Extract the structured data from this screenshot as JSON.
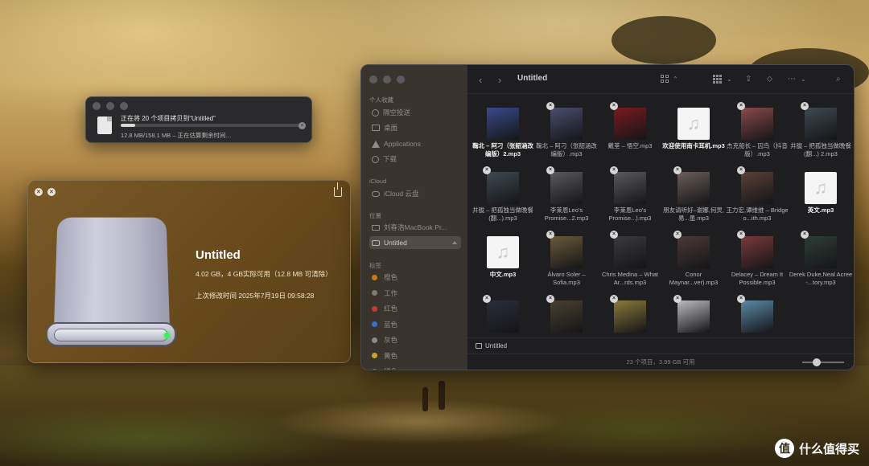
{
  "copy_dialog": {
    "title": "正在将 20 个项目拷贝到“Untitled”",
    "status": "12.8 MB/158.1 MB – 正在估算剩余时间…",
    "progress": 0.081
  },
  "info_window": {
    "name": "Untitled",
    "size": "4.02 GB，4 GB实际可用（12.8 MB 可清除）",
    "modified": "上次修改时间 2025年7月19日 09:58:28"
  },
  "finder": {
    "title": "Untitled",
    "sidebar": {
      "favorites_header": "个人收藏",
      "favorites": [
        "隔空投送",
        "桌面",
        "Applications",
        "下载"
      ],
      "icloud_header": "iCloud",
      "icloud": [
        "iCloud 云盘"
      ],
      "locations_header": "位置",
      "locations": [
        "刘春浩MacBook Pr...",
        "Untitled"
      ],
      "tags_header": "标签",
      "tags": [
        {
          "name": "橙色",
          "color": "#c8781e"
        },
        {
          "name": "工作",
          "color": "#7c7a75"
        },
        {
          "name": "红色",
          "color": "#c23a34"
        },
        {
          "name": "蓝色",
          "color": "#3b6fc2"
        },
        {
          "name": "灰色",
          "color": "#8a8a8d"
        },
        {
          "name": "黄色",
          "color": "#c9a42a"
        },
        {
          "name": "绿色",
          "color": "#3aa54a"
        }
      ]
    },
    "files": [
      {
        "name": "鞠北 – 阿刁（张韶涵改编版）2.mp3",
        "bold": true,
        "thumb": "#3a4a8a",
        "badge": false
      },
      {
        "name": "鞠北 – 阿刁（张韶涵改编版）.mp3",
        "bold": false,
        "thumb": "#4a4e6e",
        "badge": true
      },
      {
        "name": "戴荃 – 悟空.mp3",
        "bold": false,
        "thumb": "#7a1a1e",
        "badge": true
      },
      {
        "name": "欢迎使用南卡耳机.mp3",
        "bold": true,
        "thumb": "doc",
        "badge": false
      },
      {
        "name": "杰克船长 – 囚鸟（抖音版）.mp3",
        "bold": false,
        "thumb": "#8a4a4a",
        "badge": true
      },
      {
        "name": "井胧 – 把孤独当做晚餐(翻...) 2.mp3",
        "bold": false,
        "thumb": "#3e4a50",
        "badge": true
      },
      {
        "name": "井胧 – 把孤独当做晚餐(翻...).mp3",
        "bold": false,
        "thumb": "#3e4a50",
        "badge": true
      },
      {
        "name": "李莱恩Leo's Promise...2.mp3",
        "bold": false,
        "thumb": "#5a5a5e",
        "badge": true
      },
      {
        "name": "李莱恩Leo's Promise...).mp3",
        "bold": false,
        "thumb": "#5a5a5e",
        "badge": true
      },
      {
        "name": "朋友请听好–谢娜,何炅,易...虽.mp3",
        "bold": false,
        "thumb": "#6a5e58",
        "badge": true
      },
      {
        "name": "王力宏,谭维维 – Bridge o...ith.mp3",
        "bold": false,
        "thumb": "#5a4038",
        "badge": true
      },
      {
        "name": "英文.mp3",
        "bold": true,
        "thumb": "doc",
        "badge": false
      },
      {
        "name": "中文.mp3",
        "bold": true,
        "thumb": "doc",
        "badge": false
      },
      {
        "name": "Álvaro Soler – Sofia.mp3",
        "bold": false,
        "thumb": "#6a5a3a",
        "badge": true
      },
      {
        "name": "Chris Medina – What Ar...rds.mp3",
        "bold": false,
        "thumb": "#3a3a3e",
        "badge": true
      },
      {
        "name": "Conor Maynar...ver).mp3",
        "bold": false,
        "thumb": "#4a3a36",
        "badge": true
      },
      {
        "name": "Delacey – Dream It Possible.mp3",
        "bold": false,
        "thumb": "#7a3a3a",
        "badge": true
      },
      {
        "name": "Derek Duke,Neal Acree -...tory.mp3",
        "bold": false,
        "thumb": "#2e3e36",
        "badge": true
      },
      {
        "name": "",
        "bold": false,
        "thumb": "#2a2e3a",
        "badge": true
      },
      {
        "name": "",
        "bold": false,
        "thumb": "#4a4030",
        "badge": true
      },
      {
        "name": "",
        "bold": false,
        "thumb": "#8a7a3a",
        "badge": true
      },
      {
        "name": "",
        "bold": false,
        "thumb": "#bcbcc0",
        "badge": true
      },
      {
        "name": "",
        "bold": false,
        "thumb": "#5a8aa8",
        "badge": true
      }
    ],
    "path": "Untitled",
    "status": "23 个项目，3.99 GB 可用",
    "icon_size": 0.3
  },
  "watermark": {
    "logo": "值",
    "text": "什么值得买"
  }
}
